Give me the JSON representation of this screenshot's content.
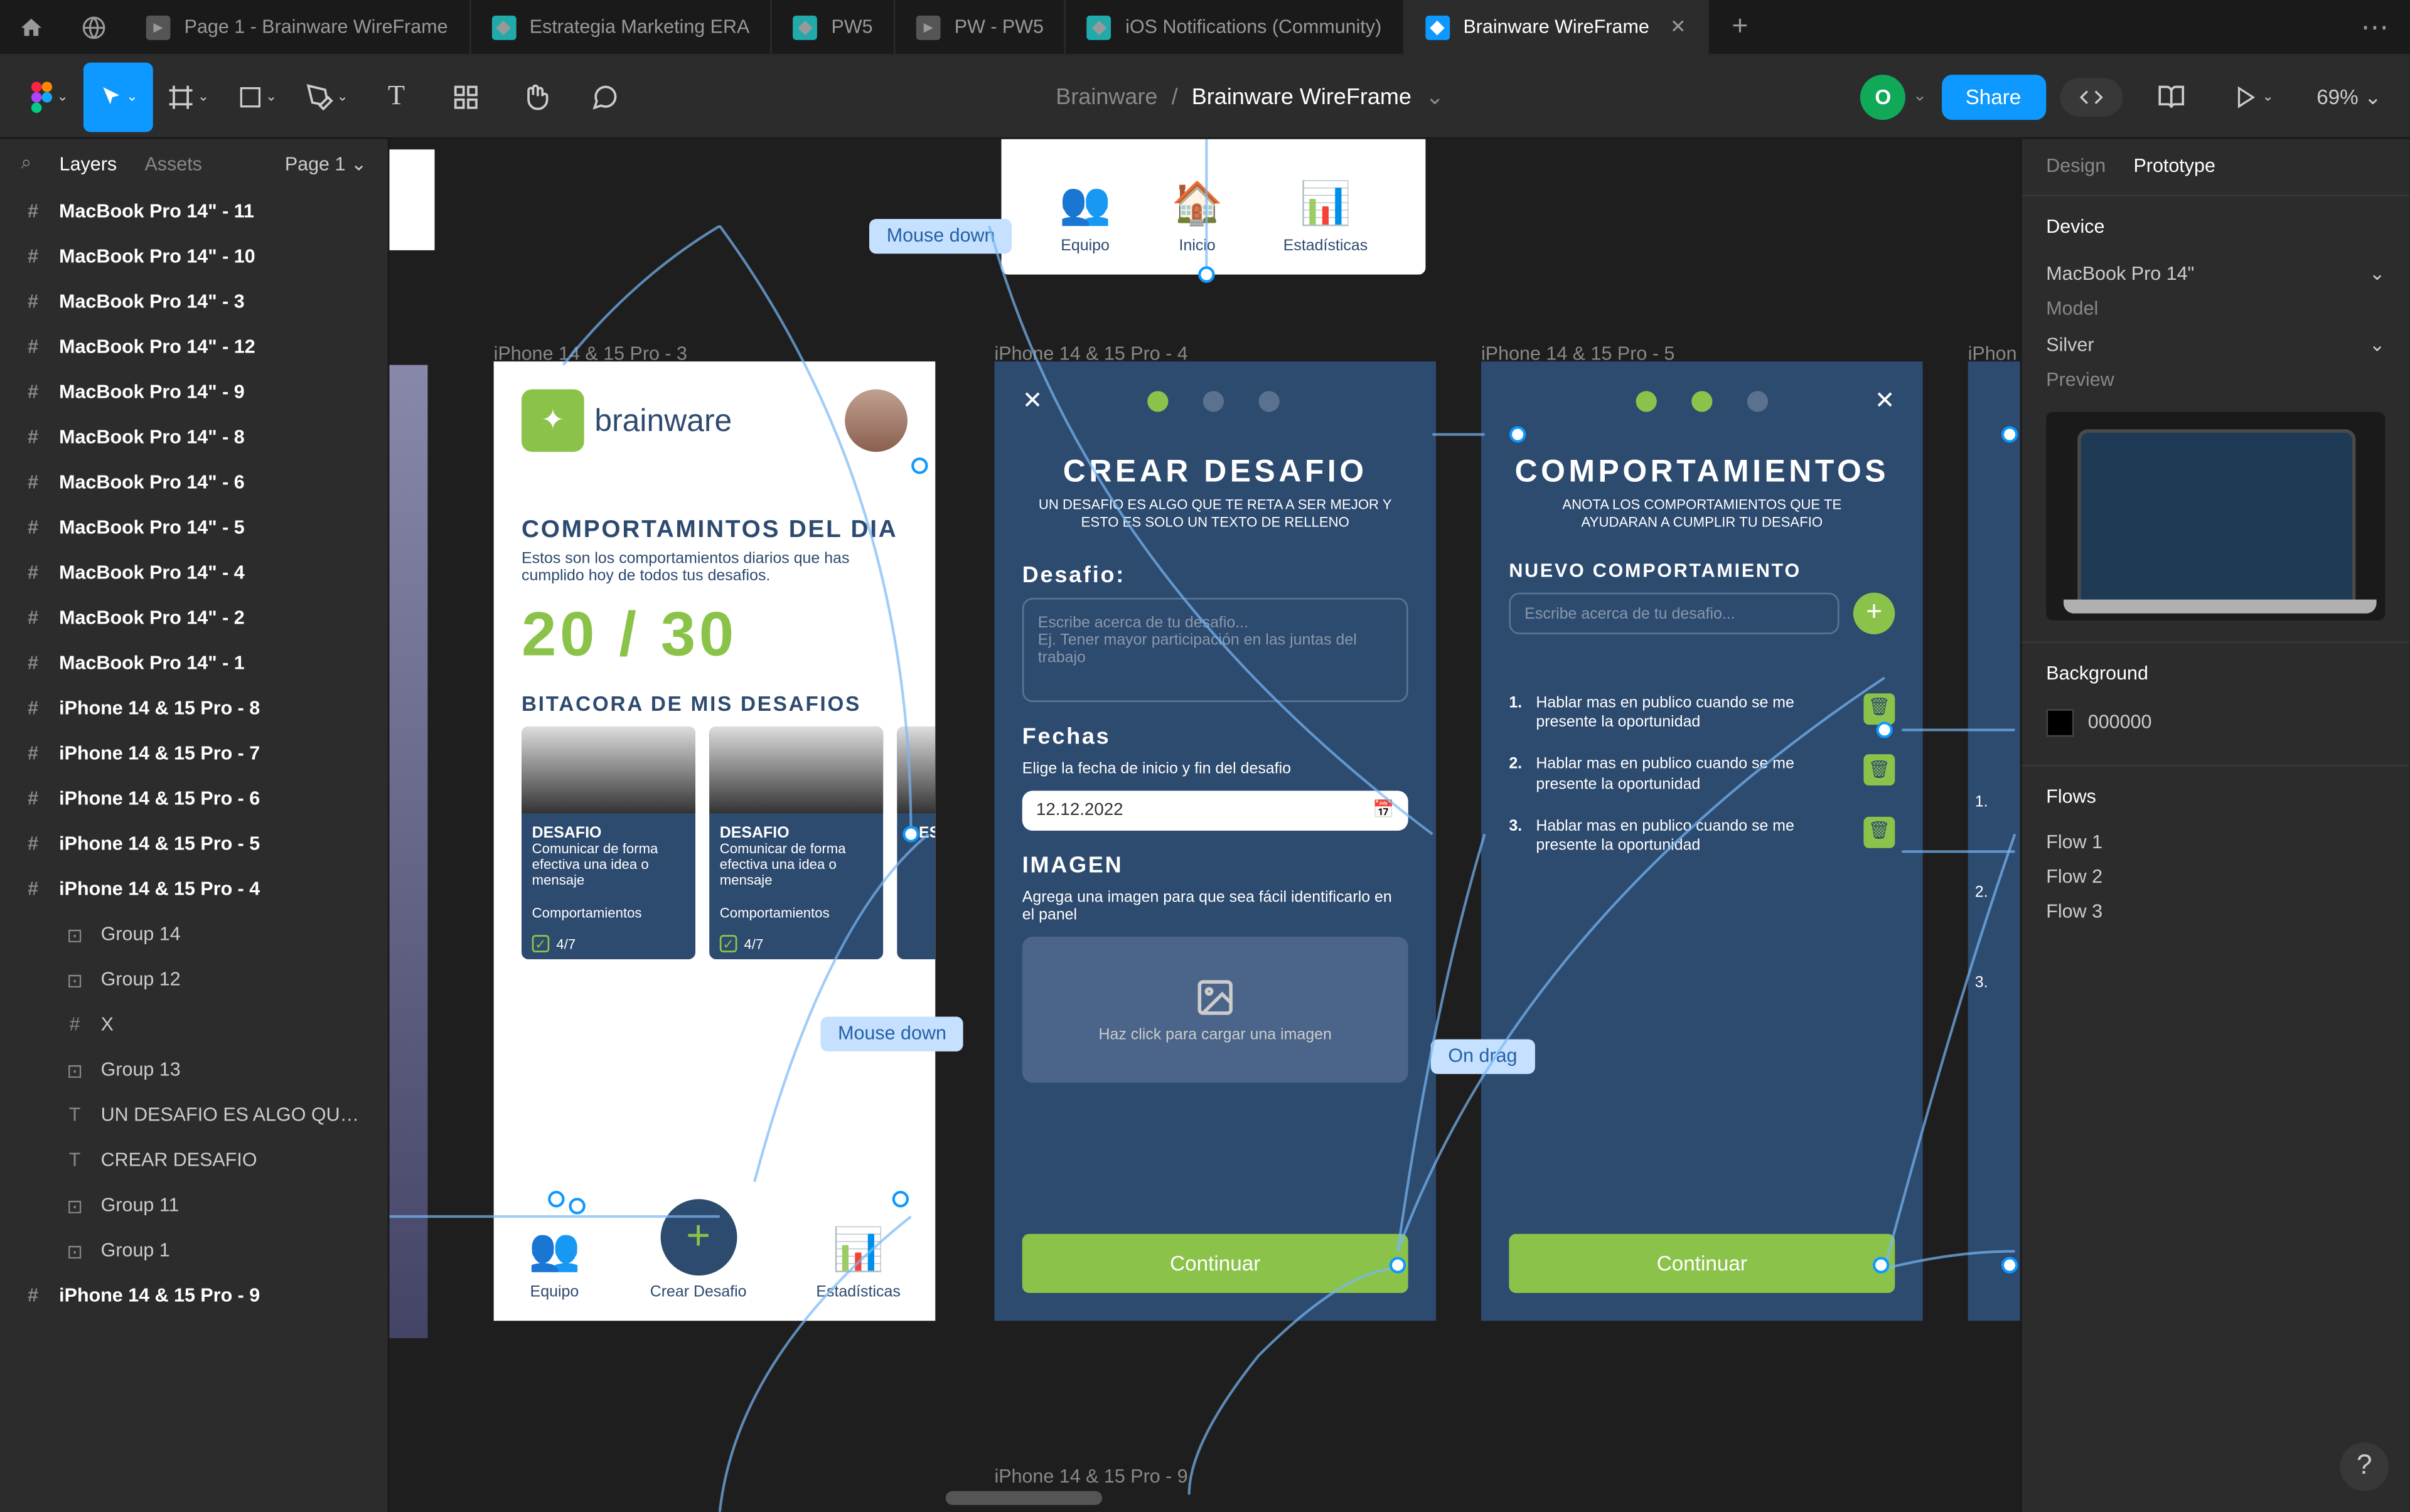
{
  "tabs": [
    {
      "label": "Page 1 - Brainware WireFrame",
      "icon": "▶",
      "color": "#555"
    },
    {
      "label": "Estrategia Marketing ERA",
      "icon": "◆",
      "color": "#3a7"
    },
    {
      "label": "PW5",
      "icon": "◆",
      "color": "#3a7"
    },
    {
      "label": "PW - PW5",
      "icon": "▶",
      "color": "#555"
    },
    {
      "label": "iOS Notifications (Community)",
      "icon": "◆",
      "color": "#3a7"
    }
  ],
  "active_tab": {
    "label": "Brainware WireFrame",
    "icon": "◆"
  },
  "breadcrumb": {
    "team": "Brainware",
    "file": "Brainware WireFrame"
  },
  "zoom": "69%",
  "share_label": "Share",
  "avatar_letter": "O",
  "left": {
    "search_label": "Layers",
    "tabs": [
      "Layers",
      "Assets"
    ],
    "page": "Page 1",
    "layers": [
      {
        "label": "MacBook Pro 14\" - 11",
        "icon": "#",
        "bold": true
      },
      {
        "label": "MacBook Pro 14\" - 10",
        "icon": "#",
        "bold": true
      },
      {
        "label": "MacBook Pro 14\" - 3",
        "icon": "#",
        "bold": true
      },
      {
        "label": "MacBook Pro 14\" - 12",
        "icon": "#",
        "bold": true
      },
      {
        "label": "MacBook Pro 14\" - 9",
        "icon": "#",
        "bold": true
      },
      {
        "label": "MacBook Pro 14\" - 8",
        "icon": "#",
        "bold": true
      },
      {
        "label": "MacBook Pro 14\" - 6",
        "icon": "#",
        "bold": true
      },
      {
        "label": "MacBook Pro 14\" - 5",
        "icon": "#",
        "bold": true
      },
      {
        "label": "MacBook Pro 14\" - 4",
        "icon": "#",
        "bold": true
      },
      {
        "label": "MacBook Pro 14\" - 2",
        "icon": "#",
        "bold": true
      },
      {
        "label": "MacBook Pro 14\" - 1",
        "icon": "#",
        "bold": true
      },
      {
        "label": "iPhone 14 & 15 Pro - 8",
        "icon": "#",
        "bold": true
      },
      {
        "label": "iPhone 14 & 15 Pro - 7",
        "icon": "#",
        "bold": true
      },
      {
        "label": "iPhone 14 & 15 Pro - 6",
        "icon": "#",
        "bold": true
      },
      {
        "label": "iPhone 14 & 15 Pro - 5",
        "icon": "#",
        "bold": true
      },
      {
        "label": "iPhone 14 & 15 Pro - 4",
        "icon": "#",
        "bold": true
      },
      {
        "label": "Group 14",
        "icon": "⊡",
        "indent": 1
      },
      {
        "label": "Group 12",
        "icon": "⊡",
        "indent": 1
      },
      {
        "label": "X",
        "icon": "#",
        "indent": 1
      },
      {
        "label": "Group 13",
        "icon": "⊡",
        "indent": 1
      },
      {
        "label": "UN DESAFIO ES ALGO QUE T...",
        "icon": "T",
        "indent": 1
      },
      {
        "label": "CREAR DESAFIO",
        "icon": "T",
        "indent": 1
      },
      {
        "label": "Group 11",
        "icon": "⊡",
        "indent": 1
      },
      {
        "label": "Group 1",
        "icon": "⊡",
        "indent": 1
      },
      {
        "label": "iPhone 14 & 15 Pro - 9",
        "icon": "#",
        "bold": true
      }
    ]
  },
  "canvas": {
    "frame_labels": {
      "f3": "iPhone 14 & 15 Pro - 3",
      "f4": "iPhone 14 & 15 Pro - 4",
      "f5": "iPhone 14 & 15 Pro - 5",
      "f6": "iPhon",
      "f9": "iPhone 14 & 15 Pro - 9"
    },
    "tags": {
      "mouse_down": "Mouse down",
      "on_drag": "On drag"
    },
    "top_nav": {
      "equipo": "Equipo",
      "inicio": "Inicio",
      "stats": "Estadísticas"
    },
    "frame3": {
      "logo": "brainware",
      "title": "COMPORTAMINTOS DEL DIA",
      "sub": "Estos son los comportamientos diarios que has cumplido hoy de todos tus desafios.",
      "count": "20 / 30",
      "section2": "BITACORA DE MIS DESAFIOS",
      "card": {
        "tag": "DESAFIO",
        "text": "Comunicar de forma efectiva una idea o mensaje",
        "footer_label": "Comportamientos",
        "footer_count": "4/7"
      },
      "nav": {
        "equipo": "Equipo",
        "crear": "Crear Desafio",
        "stats": "Estadísticas"
      }
    },
    "frame4": {
      "title": "CREAR DESAFIO",
      "sub": "UN DESAFIO ES ALGO QUE TE RETA A SER MEJOR Y ESTO ES SOLO UN TEXTO DE RELLENO",
      "desafio_label": "Desafio:",
      "desafio_ph1": "Escribe acerca de tu desafio...",
      "desafio_ph2": "Ej. Tener mayor participación en las juntas del trabajo",
      "fechas_label": "Fechas",
      "fechas_sub": "Elige la fecha de inicio y fin del desafio",
      "date_value": "12.12.2022",
      "imagen_label": "IMAGEN",
      "imagen_sub": "Agrega una imagen para que sea fácil identificarlo en el panel",
      "upload_text": "Haz click para cargar una imagen",
      "continue": "Continuar"
    },
    "frame5": {
      "title": "COMPORTAMIENTOS",
      "sub": "ANOTA LOS COMPORTAMIENTOS QUE TE AYUDARAN A CUMPLIR TU DESAFIO",
      "new_label": "NUEVO COMPORTAMIENTO",
      "input_ph": "Escribe acerca de tu desafio...",
      "item_text": "Hablar mas en publico cuando se me presente la oportunidad",
      "nums": [
        "1.",
        "2.",
        "3."
      ],
      "continue": "Continuar"
    },
    "frame6_nums": [
      "1.",
      "2.",
      "3."
    ]
  },
  "right": {
    "tabs": [
      "Design",
      "Prototype"
    ],
    "device_title": "Device",
    "device_value": "MacBook Pro 14\"",
    "model_label": "Model",
    "model_value": "Silver",
    "preview_label": "Preview",
    "bg_title": "Background",
    "bg_value": "000000",
    "flows_title": "Flows",
    "flows": [
      "Flow 1",
      "Flow 2",
      "Flow 3"
    ]
  }
}
